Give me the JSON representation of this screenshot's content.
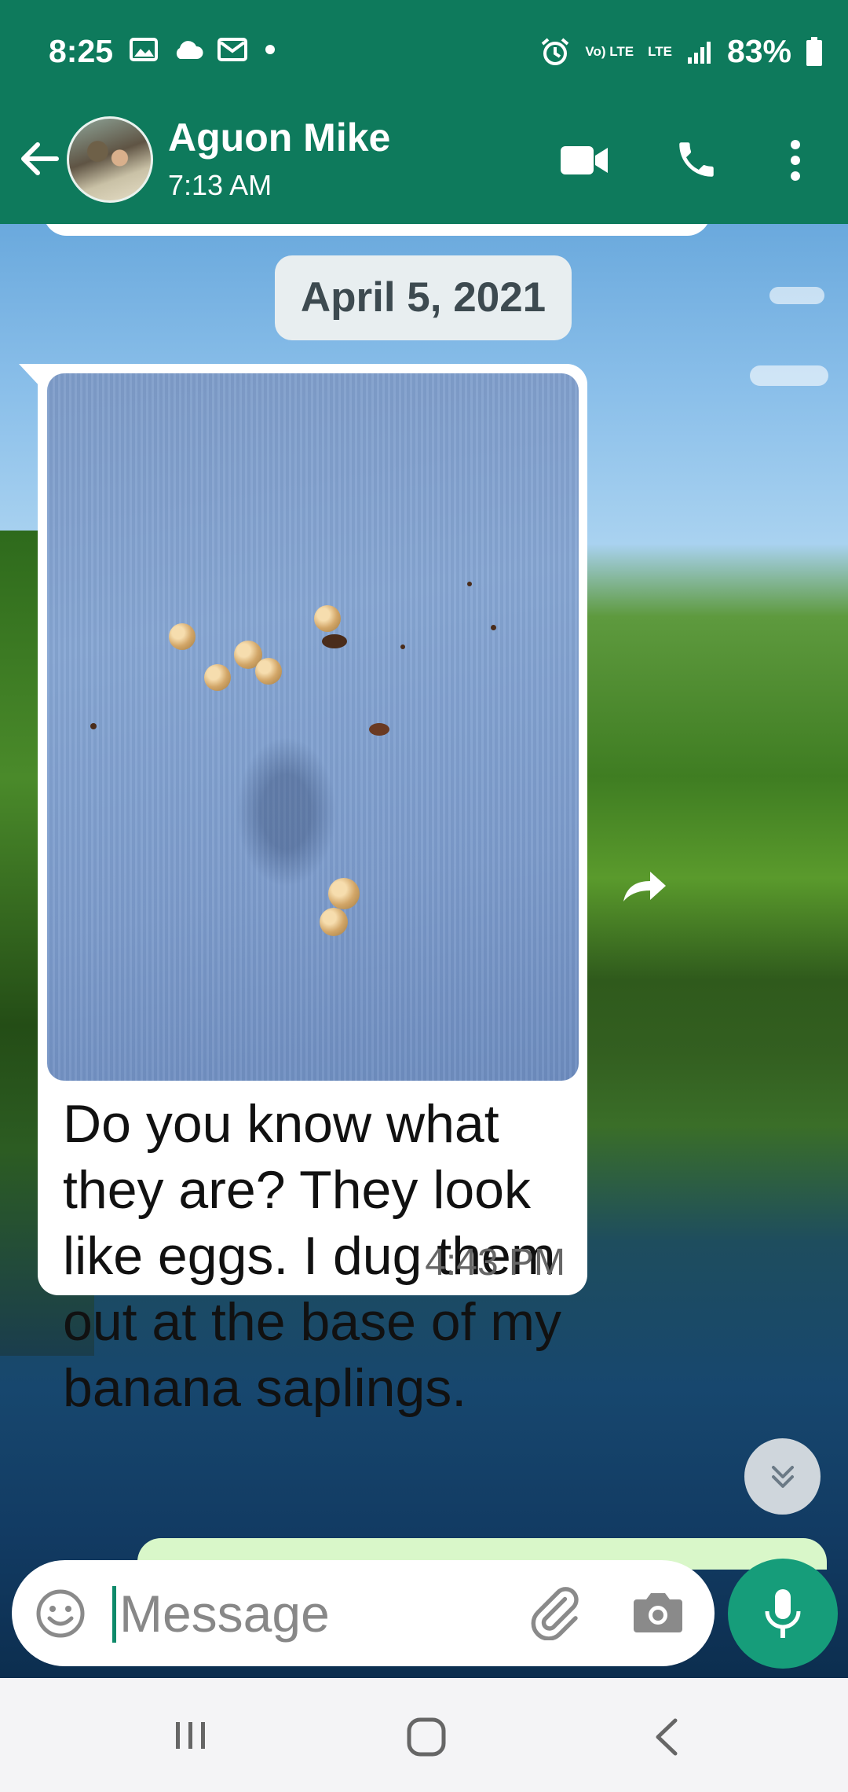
{
  "status_bar": {
    "time": "8:25",
    "battery": "83%",
    "volte_label": "Vo) LTE",
    "lte_label": "LTE",
    "icons": [
      "gallery-icon",
      "cloud-icon",
      "email-icon",
      "dot-icon",
      "alarm-icon",
      "volte-icon",
      "lte-icon",
      "signal-icon",
      "battery-icon"
    ]
  },
  "header": {
    "contact_name": "Aguon Mike",
    "subtitle": "7:13 AM",
    "icons": [
      "back-arrow-icon",
      "video-call-icon",
      "phone-icon",
      "more-vert-icon"
    ]
  },
  "chat": {
    "date_chip": "April 5, 2021",
    "message": {
      "text": "Do you know what they are? They look like eggs. I dug them out at the base of my banana saplings.",
      "time": "4:43 PM",
      "has_photo": true
    }
  },
  "composer": {
    "placeholder": "Message",
    "value": "",
    "icons": [
      "emoji-icon",
      "paperclip-icon",
      "camera-icon",
      "mic-icon"
    ]
  },
  "navbar": {
    "icons": [
      "recents-icon",
      "home-icon",
      "back-icon"
    ]
  },
  "colors": {
    "primary": "#0e7a5c",
    "mic_button": "#169d7a",
    "outgoing_bubble": "#d9f7c9"
  }
}
